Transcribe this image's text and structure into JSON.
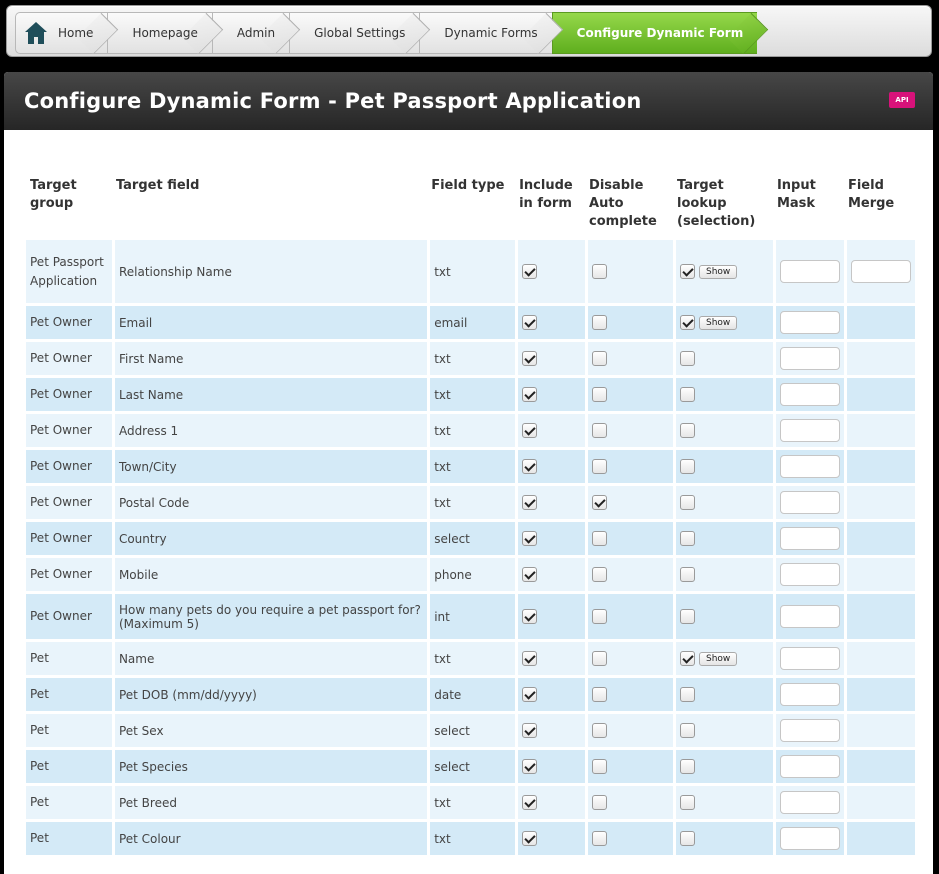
{
  "breadcrumb": {
    "items": [
      {
        "label": "Home"
      },
      {
        "label": "Homepage"
      },
      {
        "label": "Admin"
      },
      {
        "label": "Global Settings"
      },
      {
        "label": "Dynamic Forms"
      },
      {
        "label": "Configure Dynamic Form",
        "active": true
      }
    ]
  },
  "panel": {
    "title": "Configure Dynamic Form - Pet Passport Application",
    "api_badge": "API"
  },
  "table": {
    "headers": [
      "Target group",
      "Target field",
      "Field type",
      "Include in form",
      "Disable Auto complete",
      "Target lookup (selection)",
      "Input Mask",
      "Field Merge"
    ],
    "show_label": "Show",
    "rows": [
      {
        "group": "Pet Passport Application",
        "field": "Relationship Name",
        "type": "txt",
        "include": true,
        "disable_auto": false,
        "lookup": true,
        "show_button": true,
        "merge": true
      },
      {
        "group": "Pet Owner",
        "field": "Email",
        "type": "email",
        "include": true,
        "disable_auto": false,
        "lookup": true,
        "show_button": true,
        "merge": false
      },
      {
        "group": "Pet Owner",
        "field": "First Name",
        "type": "txt",
        "include": true,
        "disable_auto": false,
        "lookup": false,
        "show_button": false,
        "merge": false
      },
      {
        "group": "Pet Owner",
        "field": "Last Name",
        "type": "txt",
        "include": true,
        "disable_auto": false,
        "lookup": false,
        "show_button": false,
        "merge": false
      },
      {
        "group": "Pet Owner",
        "field": "Address 1",
        "type": "txt",
        "include": true,
        "disable_auto": false,
        "lookup": false,
        "show_button": false,
        "merge": false
      },
      {
        "group": "Pet Owner",
        "field": "Town/City",
        "type": "txt",
        "include": true,
        "disable_auto": false,
        "lookup": false,
        "show_button": false,
        "merge": false
      },
      {
        "group": "Pet Owner",
        "field": "Postal Code",
        "type": "txt",
        "include": true,
        "disable_auto": true,
        "lookup": false,
        "show_button": false,
        "merge": false
      },
      {
        "group": "Pet Owner",
        "field": "Country",
        "type": "select",
        "include": true,
        "disable_auto": false,
        "lookup": false,
        "show_button": false,
        "merge": false
      },
      {
        "group": "Pet Owner",
        "field": "Mobile",
        "type": "phone",
        "include": true,
        "disable_auto": false,
        "lookup": false,
        "show_button": false,
        "merge": false
      },
      {
        "group": "Pet Owner",
        "field": "How many pets do you require a pet passport for? (Maximum 5)",
        "type": "int",
        "include": true,
        "disable_auto": false,
        "lookup": false,
        "show_button": false,
        "merge": false
      },
      {
        "group": "Pet",
        "field": "Name",
        "type": "txt",
        "include": true,
        "disable_auto": false,
        "lookup": true,
        "show_button": true,
        "merge": false
      },
      {
        "group": "Pet",
        "field": "Pet DOB (mm/dd/yyyy)",
        "type": "date",
        "include": true,
        "disable_auto": false,
        "lookup": false,
        "show_button": false,
        "merge": false
      },
      {
        "group": "Pet",
        "field": "Pet Sex",
        "type": "select",
        "include": true,
        "disable_auto": false,
        "lookup": false,
        "show_button": false,
        "merge": false
      },
      {
        "group": "Pet",
        "field": "Pet Species",
        "type": "select",
        "include": true,
        "disable_auto": false,
        "lookup": false,
        "show_button": false,
        "merge": false
      },
      {
        "group": "Pet",
        "field": "Pet Breed",
        "type": "txt",
        "include": true,
        "disable_auto": false,
        "lookup": false,
        "show_button": false,
        "merge": false
      },
      {
        "group": "Pet",
        "field": "Pet Colour",
        "type": "txt",
        "include": true,
        "disable_auto": false,
        "lookup": false,
        "show_button": false,
        "merge": false
      }
    ]
  }
}
